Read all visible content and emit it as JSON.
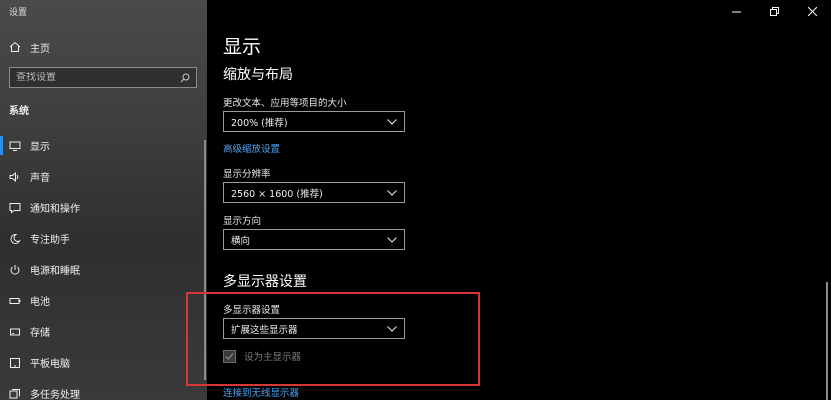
{
  "window": {
    "title": "设置"
  },
  "sidebar": {
    "home_label": "主页",
    "search_placeholder": "查找设置",
    "section_label": "系统",
    "items": [
      {
        "label": "显示",
        "icon": "monitor-icon",
        "active": true
      },
      {
        "label": "声音",
        "icon": "speaker-icon"
      },
      {
        "label": "通知和操作",
        "icon": "message-icon"
      },
      {
        "label": "专注助手",
        "icon": "moon-icon"
      },
      {
        "label": "电源和睡眠",
        "icon": "power-icon"
      },
      {
        "label": "电池",
        "icon": "battery-icon"
      },
      {
        "label": "存储",
        "icon": "storage-icon"
      },
      {
        "label": "平板电脑",
        "icon": "tablet-icon"
      },
      {
        "label": "多任务处理",
        "icon": "multitask-icon"
      }
    ]
  },
  "main": {
    "page_title": "显示",
    "scale_section": {
      "heading": "缩放与布局",
      "text_scale_label": "更改文本、应用等项目的大小",
      "text_scale_value": "200% (推荐)",
      "advanced_link": "高级缩放设置",
      "resolution_label": "显示分辨率",
      "resolution_value": "2560 × 1600 (推荐)",
      "orientation_label": "显示方向",
      "orientation_value": "横向"
    },
    "multi_display_section": {
      "heading": "多显示器设置",
      "mode_label": "多显示器设置",
      "mode_value": "扩展这些显示器",
      "primary_checkbox_label": "设为主显示器",
      "wireless_link": "连接到无线显示器"
    }
  },
  "colors": {
    "accent": "#2f8fe8",
    "link": "#4fa3f0",
    "highlight": "#d93636"
  }
}
